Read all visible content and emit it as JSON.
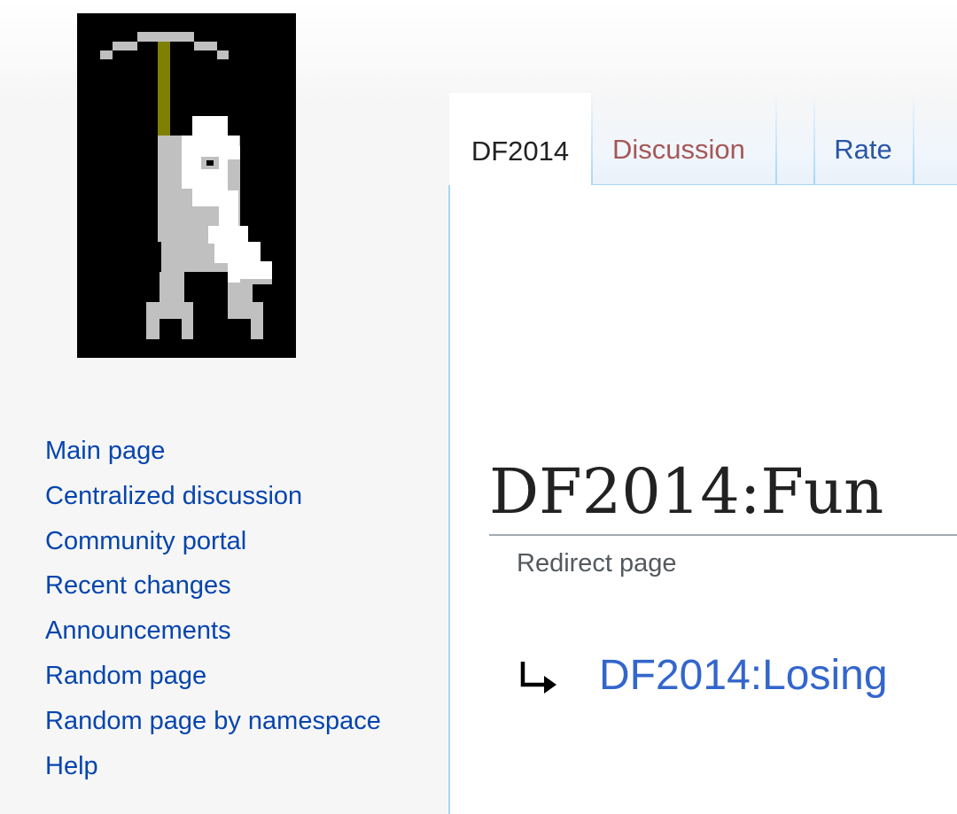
{
  "logo": {
    "icon": "dwarf-with-pickaxe-logo",
    "colors": {
      "background": "#000000",
      "pick_head": "#c0c0c0",
      "pick_handle": "#808000",
      "body": "#c0c0c0",
      "beard": "#ffffff"
    }
  },
  "sidebar": {
    "items": [
      {
        "label": "Main page"
      },
      {
        "label": "Centralized discussion"
      },
      {
        "label": "Community portal"
      },
      {
        "label": "Recent changes"
      },
      {
        "label": "Announcements"
      },
      {
        "label": "Random page"
      },
      {
        "label": "Random page by namespace"
      },
      {
        "label": "Help"
      }
    ]
  },
  "tabs": {
    "namespace": {
      "label": "DF2014",
      "selected": true
    },
    "discussion": {
      "label": "Discussion",
      "state": "new"
    },
    "rate": {
      "label": "Rate"
    }
  },
  "content": {
    "title": "DF2014:Fun",
    "subtitle": "Redirect page",
    "redirect": {
      "icon": "redirect-arrow-icon",
      "target": "DF2014:Losing"
    }
  },
  "colors": {
    "link": "#0645ad",
    "new_link": "#ba0000",
    "tab_border": "#a7d7f9",
    "heading_rule": "#a2a9b1"
  }
}
